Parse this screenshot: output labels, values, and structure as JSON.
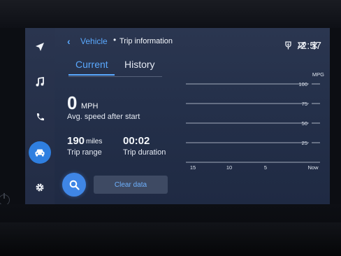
{
  "breadcrumb": {
    "back_glyph": "‹",
    "parent": "Vehicle",
    "separator": "•",
    "current": "Trip information"
  },
  "status": {
    "icons": [
      "wireless-charging-icon",
      "mute-icon",
      "bluetooth-icon"
    ],
    "time": "2:57"
  },
  "rail": {
    "items": [
      {
        "name": "navigation-icon"
      },
      {
        "name": "music-icon"
      },
      {
        "name": "phone-icon"
      },
      {
        "name": "vehicle-icon",
        "active": true
      },
      {
        "name": "settings-icon"
      }
    ]
  },
  "tabs": [
    {
      "label": "Current",
      "selected": true
    },
    {
      "label": "History",
      "selected": false
    }
  ],
  "stats": {
    "speed": {
      "value": "0",
      "unit": "MPH",
      "label": "Avg. speed after start"
    },
    "range": {
      "value": "190",
      "unit": "miles",
      "label": "Trip range"
    },
    "duration": {
      "value": "00:02",
      "label": "Trip duration"
    }
  },
  "actions": {
    "search_icon": "search-icon",
    "clear_label": "Clear data"
  },
  "colors": {
    "accent": "#5aa9ff",
    "active_button": "#3f86e6",
    "screen_bg": "#24304a"
  },
  "chart_data": {
    "type": "line",
    "ylabel": "MPG",
    "y_ticks": [
      "100",
      "75",
      "50",
      "25"
    ],
    "x_ticks": [
      "15",
      "10",
      "5",
      "Now"
    ],
    "ylim": [
      0,
      100
    ],
    "grid": true,
    "series": []
  }
}
